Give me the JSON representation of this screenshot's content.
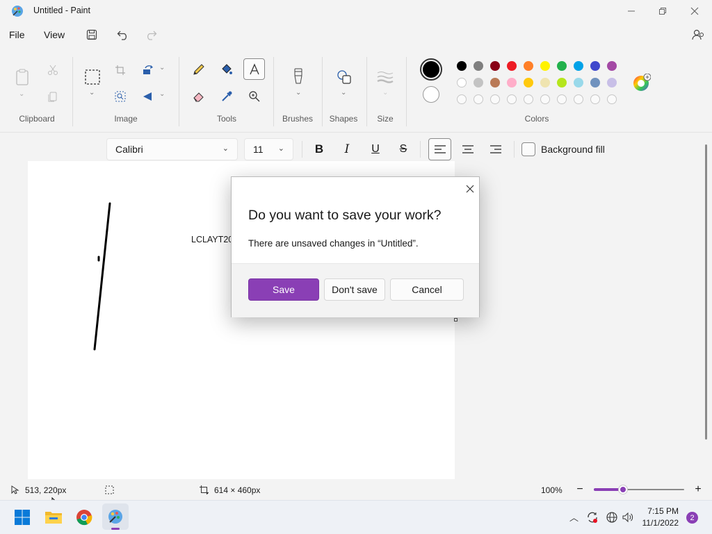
{
  "window": {
    "title": "Untitled - Paint"
  },
  "menu": {
    "file": "File",
    "view": "View"
  },
  "ribbon": {
    "groups": {
      "clipboard": "Clipboard",
      "image": "Image",
      "tools": "Tools",
      "brushes": "Brushes",
      "shapes": "Shapes",
      "size": "Size",
      "colors": "Colors"
    }
  },
  "colors": {
    "primary": "#000000",
    "secondary": "#ffffff",
    "accent": "#8a3fb5",
    "row1": [
      "#000000",
      "#7f7f7f",
      "#880015",
      "#ed1c24",
      "#ff7f27",
      "#fff200",
      "#22b14c",
      "#00a2e8",
      "#3f48cc",
      "#a349a4"
    ],
    "row2": [
      "#ffffff",
      "#c3c3c3",
      "#b97a57",
      "#ffaec9",
      "#ffc90e",
      "#efe4b0",
      "#b5e61d",
      "#99d9ea",
      "#7092be",
      "#c8bfe7"
    ]
  },
  "text_toolbar": {
    "font": "Calibri",
    "size": "11",
    "background_fill": "Background fill"
  },
  "canvas": {
    "text": "LCLAYT20"
  },
  "dialog": {
    "title": "Do you want to save your work?",
    "message": "There are unsaved changes in “Untitled”.",
    "save": "Save",
    "dont_save": "Don't save",
    "cancel": "Cancel"
  },
  "statusbar": {
    "cursor_pos": "513, 220px",
    "canvas_size": "614 × 460px",
    "zoom": "100%",
    "zoom_fraction": 0.32
  },
  "taskbar": {
    "time": "7:15 PM",
    "date": "11/1/2022",
    "notification_count": "2"
  }
}
